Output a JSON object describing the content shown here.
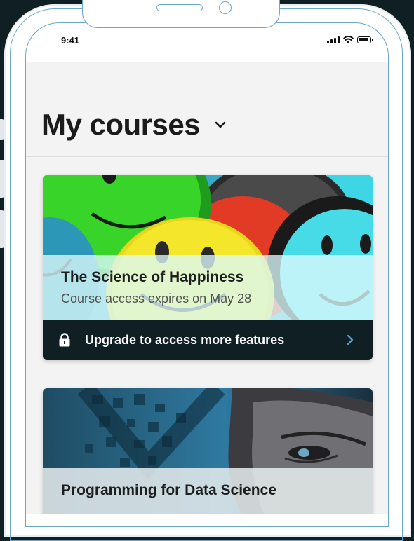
{
  "status_bar": {
    "time": "9:41",
    "icons": [
      "signal-icon",
      "wifi-icon",
      "battery-icon"
    ]
  },
  "header": {
    "title": "My courses",
    "dropdown_icon": "chevron-down-icon"
  },
  "courses": [
    {
      "title": "The Science of Happiness",
      "subtitle": "Course access expires on May 28",
      "upgrade_label": "Upgrade to access more features",
      "lock_icon": "lock-icon",
      "arrow_icon": "chevron-right-icon",
      "image": "smiley-faces-image"
    },
    {
      "title": "Programming for Data Science",
      "image": "data-science-face-image"
    }
  ],
  "colors": {
    "dark": "#0f1f24",
    "accent": "#5aa9d6",
    "outline": "#6aa7c8"
  }
}
